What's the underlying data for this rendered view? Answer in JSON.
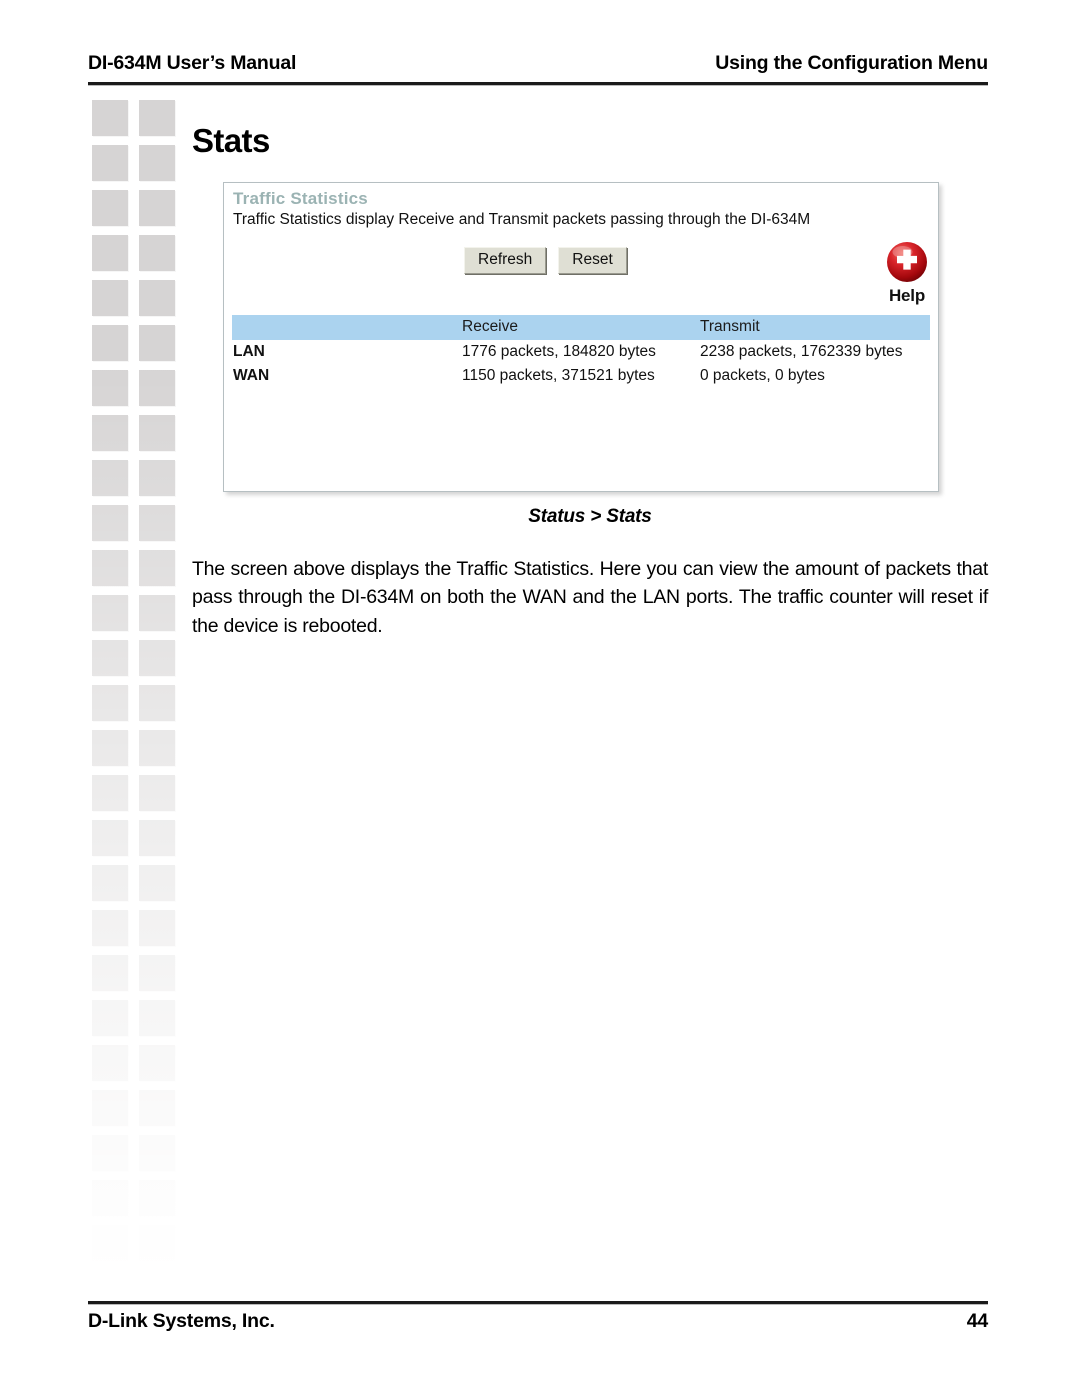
{
  "header": {
    "left": "DI-634M User’s Manual",
    "right": "Using the Configuration Menu"
  },
  "section": {
    "title": "Stats"
  },
  "screenshot": {
    "panel_title": "Traffic Statistics",
    "panel_description": "Traffic Statistics display Receive and Transmit packets passing through the DI-634M",
    "buttons": {
      "refresh": "Refresh",
      "reset": "Reset"
    },
    "help": {
      "label": "Help",
      "icon": "help-plus-icon",
      "color": "#c01014"
    },
    "table": {
      "header_bg": "#abd3ef",
      "columns": [
        "",
        "Receive",
        "Transmit"
      ],
      "rows": [
        {
          "interface": "LAN",
          "receive": "1776 packets, 184820 bytes",
          "transmit": "2238 packets, 1762339 bytes"
        },
        {
          "interface": "WAN",
          "receive": "1150 packets, 371521 bytes",
          "transmit": "0 packets, 0 bytes"
        }
      ]
    }
  },
  "caption": "Status > Stats",
  "body": "The screen above displays the Traffic Statistics. Here you can view the amount of packets that pass through the DI-634M on both the WAN and the LAN ports. The traffic counter will reset if the device is rebooted.",
  "footer": {
    "left": "D-Link Systems, Inc.",
    "page_number": "44"
  }
}
